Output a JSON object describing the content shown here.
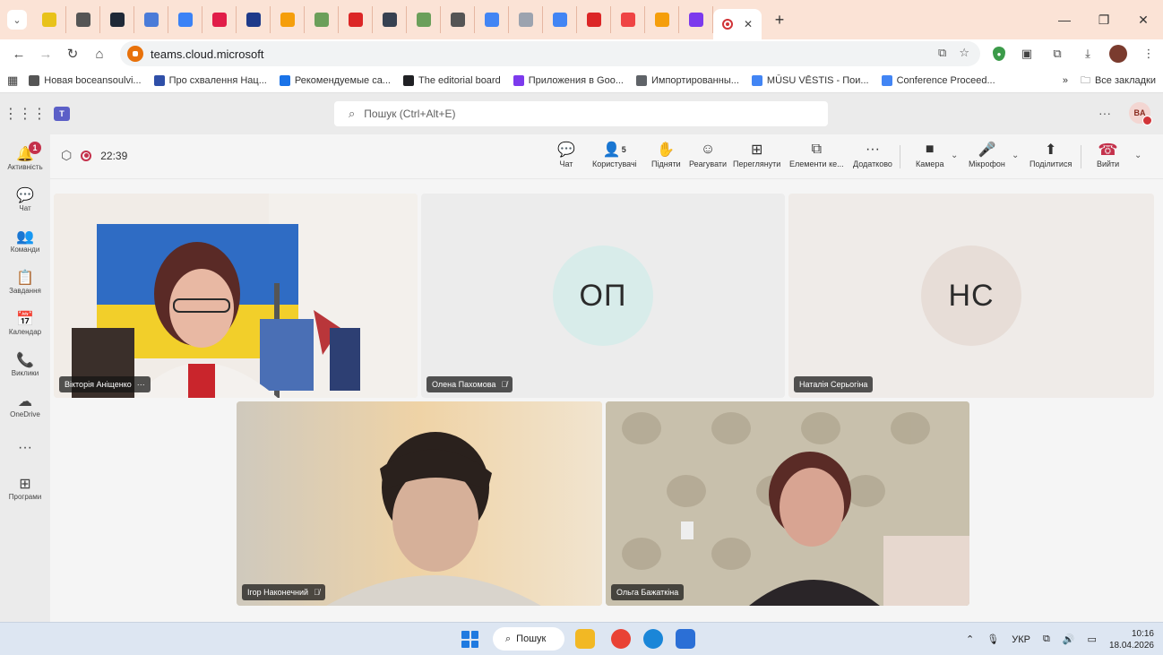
{
  "browser": {
    "tab_icon_colors": [
      "#e8c21a",
      "#555555",
      "#1f2937",
      "#4a7bd8",
      "#3b82f6",
      "#e11d48",
      "#1e3a8a",
      "#f59e0b",
      "#6b9f5a",
      "#dc2626",
      "#374151",
      "#6b9f5a",
      "#555555",
      "#4285f4",
      "#9ca3af",
      "#4285f4",
      "#dc2626",
      "#ef4444",
      "#f59e0b",
      "#7c3aed"
    ],
    "new_tab_label": "+",
    "url": "teams.cloud.microsoft",
    "bookmarks": [
      {
        "label": "Новая boceansoulvi...",
        "color": "#555555"
      },
      {
        "label": "Про схвалення Нац...",
        "color": "#2f4fa8"
      },
      {
        "label": "Рекомендуемые са...",
        "color": "#1a73e8"
      },
      {
        "label": "The editorial board",
        "color": "#202124"
      },
      {
        "label": "Приложения в Goo...",
        "color": "#7c3aed"
      },
      {
        "label": "Импортированны...",
        "color": "#5f6368"
      },
      {
        "label": "MŪSU VĒSTIS - Пои...",
        "color": "#4285f4"
      },
      {
        "label": "Conference Proceed...",
        "color": "#4285f4"
      }
    ],
    "bookmarks_overflow": "»",
    "all_bookmarks": "Все закладки"
  },
  "teams": {
    "search_placeholder": "Пошук (Ctrl+Alt+E)",
    "me_initials": "BA",
    "more": "···",
    "rail": [
      {
        "icon": "bell-icon",
        "glyph": "🔔",
        "label": "Активність",
        "badge": "1"
      },
      {
        "icon": "chat-icon",
        "glyph": "💬",
        "label": "Чат"
      },
      {
        "icon": "teams-icon",
        "glyph": "👥",
        "label": "Команди"
      },
      {
        "icon": "tasks-icon",
        "glyph": "📋",
        "label": "Завдання"
      },
      {
        "icon": "calendar-icon",
        "glyph": "📅",
        "label": "Календар"
      },
      {
        "icon": "calls-icon",
        "glyph": "📞",
        "label": "Виклики"
      },
      {
        "icon": "onedrive-icon",
        "glyph": "☁",
        "label": "OneDrive"
      },
      {
        "icon": "more-icon",
        "glyph": "···",
        "label": ""
      },
      {
        "icon": "apps-icon",
        "glyph": "⊞",
        "label": "Програми"
      }
    ]
  },
  "meeting": {
    "timer": "22:39",
    "participants_count": "5",
    "toolbar": {
      "chat": "Чат",
      "people": "Користувачі",
      "raise": "Підняти",
      "react": "Реагувати",
      "view": "Переглянути",
      "apps": "Елементи ке...",
      "more": "Додатково",
      "camera": "Камера",
      "mic": "Мікрофон",
      "share": "Поділитися",
      "leave": "Вийти"
    },
    "participants": [
      {
        "name": "Вікторія Аніщенко",
        "extra": "···"
      },
      {
        "name": "Олена Пахомова",
        "initials": "ОП",
        "muted": true
      },
      {
        "name": "Наталія Серьогіна",
        "initials": "НС"
      },
      {
        "name": "Ігор Наконечний",
        "muted": true
      },
      {
        "name": "Ольга Бажаткіна"
      }
    ]
  },
  "taskbar": {
    "search": "Пошук",
    "lang": "УКР",
    "time": "10:16",
    "date": "18.04.2026"
  }
}
